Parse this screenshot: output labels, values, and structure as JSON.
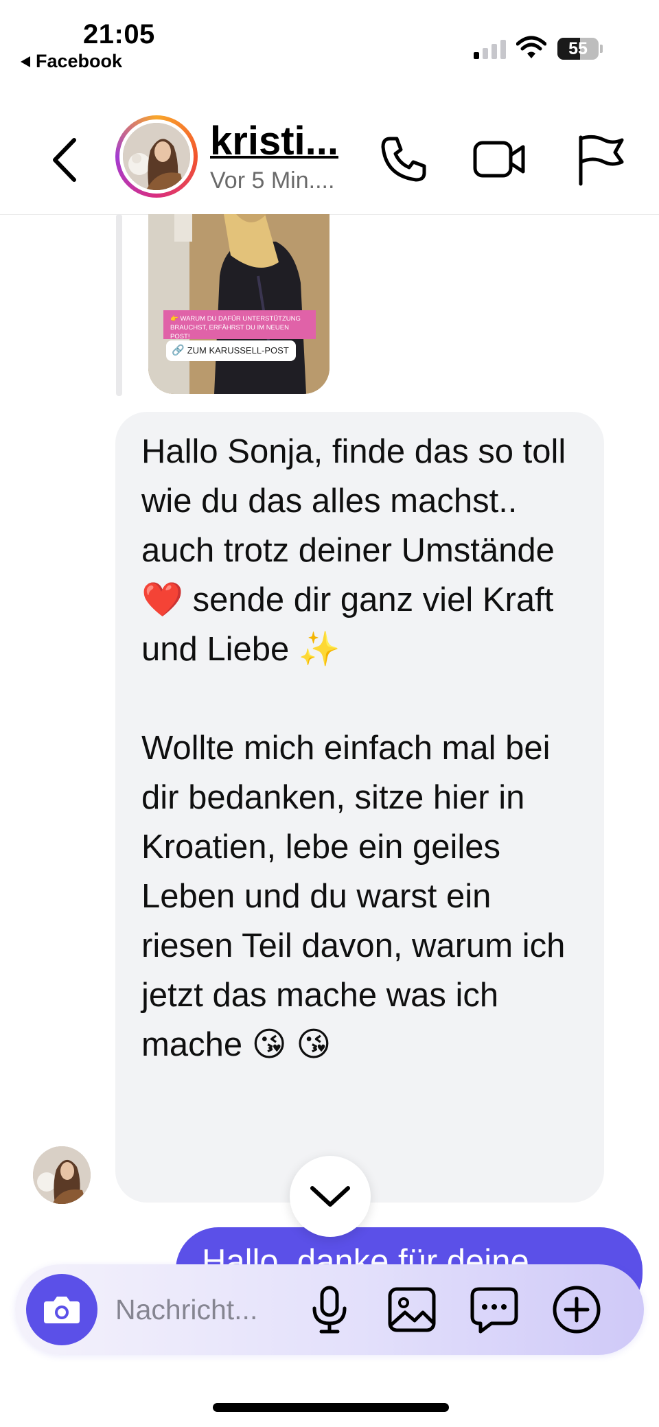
{
  "status_bar": {
    "time": "21:05",
    "back_app": "Facebook",
    "battery_level": "55",
    "battery_fraction": 0.55
  },
  "header": {
    "contact_name": "kristi...",
    "active_status": "Vor 5 Min....",
    "icons": [
      "chevron-left-icon",
      "phone-icon",
      "video-camera-icon",
      "flag-icon"
    ]
  },
  "story_reply": {
    "banner_text": "👉 WARUM DU DAFÜR UNTERSTÜTZUNG BRAUCHST, ERFÄHRST DU IM NEUEN POST!",
    "link_label": "ZUM KARUSSELL-POST"
  },
  "messages": {
    "incoming_paragraph_1": "Hallo Sonja, finde das so toll wie du das alles machst.. auch trotz deiner Umstände ❤️ sende dir ganz viel Kraft und Liebe ✨",
    "incoming_paragraph_2": "Wollte mich einfach mal bei dir bedanken, sitze hier in Kroatien, lebe ein geiles Leben und du warst ein riesen Teil davon, warum ich jetzt das mache was ich mache 😘 😘",
    "outgoing_partial": "Hallo, danke für deine"
  },
  "composer": {
    "placeholder": "Nachricht...",
    "icons": [
      "camera-icon",
      "microphone-icon",
      "gallery-icon",
      "chat-bubble-icon",
      "plus-circle-icon"
    ]
  },
  "colors": {
    "accent": "#5b50e8",
    "bubble_incoming": "#f2f3f5",
    "ring_gradient": [
      "#f9a72b",
      "#f2542d",
      "#d92e7f",
      "#a33cd1"
    ]
  }
}
